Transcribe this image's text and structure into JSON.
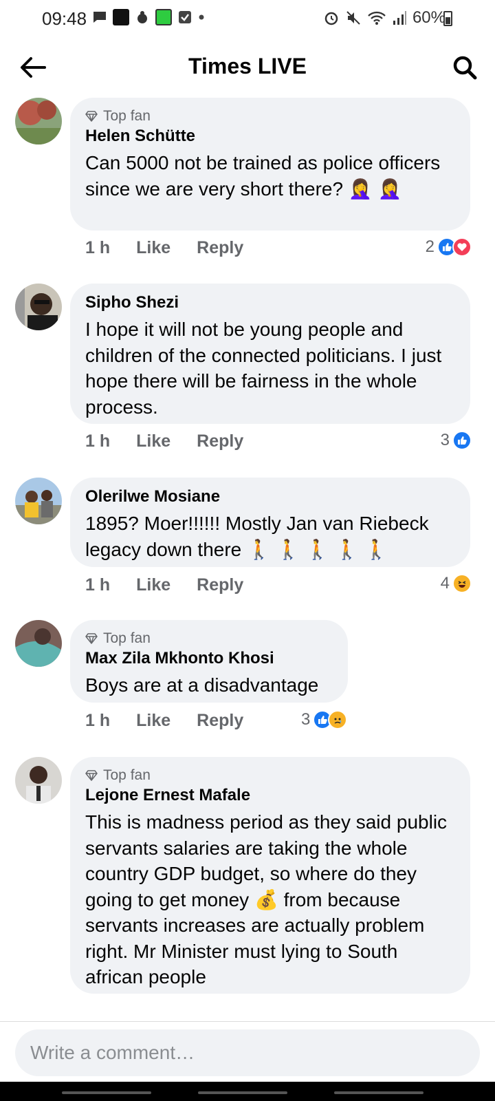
{
  "status_bar": {
    "time": "09:48",
    "battery": "60%",
    "icons": [
      "message-icon",
      "app-icon",
      "app-icon-2",
      "green-app-icon",
      "check-icon",
      "dot-icon",
      "alarm-icon",
      "mute-icon",
      "wifi-icon",
      "signal-icon",
      "battery-icon"
    ]
  },
  "header": {
    "title": "Times LIVE",
    "back_icon": "arrow-left-icon",
    "search_icon": "search-icon"
  },
  "top_fan_label": "Top fan",
  "comments": [
    {
      "author": "Helen Schütte",
      "top_fan": true,
      "text": "Can 5000 not be trained as police officers since we are very short there? 🤦‍♀️ 🤦‍♀️",
      "time": "1 h",
      "like": "Like",
      "reply": "Reply",
      "reaction_count": "2",
      "reactions": [
        "like",
        "love"
      ]
    },
    {
      "author": "Sipho Shezi",
      "top_fan": false,
      "text": "I hope it will not be young people and children of the connected politicians. I just hope there will be fairness in the whole process.",
      "time": "1 h",
      "like": "Like",
      "reply": "Reply",
      "reaction_count": "3",
      "reactions": [
        "like"
      ]
    },
    {
      "author": "Olerilwe Mosiane",
      "top_fan": false,
      "text": "1895? Moer!!!!!! Mostly Jan van Riebeck legacy down there 🚶 🚶 🚶 🚶 🚶",
      "time": "1 h",
      "like": "Like",
      "reply": "Reply",
      "reaction_count": "4",
      "reactions": [
        "haha"
      ]
    },
    {
      "author": "Max Zila Mkhonto Khosi",
      "top_fan": true,
      "text": "Boys are at a disadvantage",
      "time": "1 h",
      "like": "Like",
      "reply": "Reply",
      "reaction_count": "3",
      "reactions": [
        "like",
        "sad"
      ]
    },
    {
      "author": "Lejone Ernest Mafale",
      "top_fan": true,
      "text": "This is madness period as they said public servants salaries are taking the whole country GDP budget, so where do they going to get money 💰 from because servants increases are actually problem right. Mr Minister must lying to South african people"
    }
  ],
  "composer": {
    "placeholder": "Write a comment…"
  },
  "colors": {
    "bubble": "#f0f2f5",
    "secondary_text": "#65676b",
    "like_blue": "#1877f2",
    "love_red": "#f33e58",
    "haha_yellow": "#f7b125"
  }
}
